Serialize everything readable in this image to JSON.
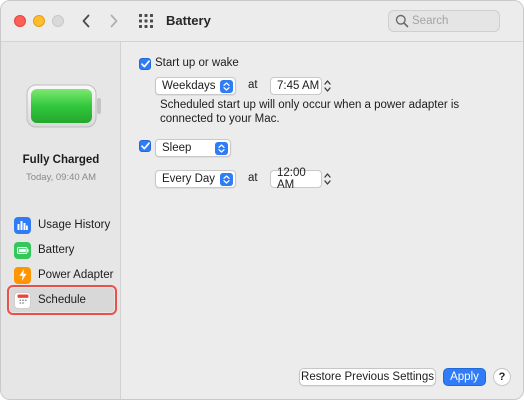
{
  "toolbar": {
    "title": "Battery",
    "search_placeholder": "Search"
  },
  "sidebar": {
    "status_main": "Fully Charged",
    "status_sub": "Today, 09:40 AM",
    "items": [
      {
        "label": "Usage History",
        "icon": "bar-chart-icon",
        "color": "#2f7cf6"
      },
      {
        "label": "Battery",
        "icon": "battery-icon",
        "color": "#34c759"
      },
      {
        "label": "Power Adapter",
        "icon": "lightning-icon",
        "color": "#ff9500"
      },
      {
        "label": "Schedule",
        "icon": "calendar-icon",
        "color": "#ffffff",
        "selected": true
      }
    ]
  },
  "schedule": {
    "startup": {
      "checked": true,
      "label": "Start up or wake",
      "days": "Weekdays",
      "at": "at",
      "time": "7:45 AM",
      "note": "Scheduled start up will only occur when a power adapter is connected to your Mac."
    },
    "sleep": {
      "checked": true,
      "action": "Sleep",
      "days": "Every Day",
      "at": "at",
      "time": "12:00 AM"
    }
  },
  "buttons": {
    "restore": "Restore Previous Settings",
    "apply": "Apply",
    "help": "?"
  },
  "colors": {
    "accent": "#2f7cf6",
    "battery_green": "#30c53f",
    "selection_outline": "#e8524d"
  }
}
